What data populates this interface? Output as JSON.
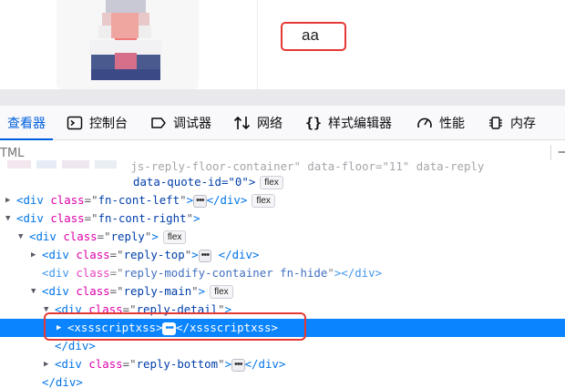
{
  "page": {
    "comment_text": "aa"
  },
  "toolbar": {
    "tabs": [
      {
        "label": "查看器",
        "icon": "inspector-icon",
        "active": true
      },
      {
        "label": "控制台",
        "icon": "console-icon",
        "active": false
      },
      {
        "label": "调试器",
        "icon": "debugger-icon",
        "active": false
      },
      {
        "label": "网络",
        "icon": "network-icon",
        "active": false
      },
      {
        "label": "样式编辑器",
        "icon": "style-editor-icon",
        "active": false
      },
      {
        "label": "性能",
        "icon": "performance-icon",
        "active": false
      },
      {
        "label": "内存",
        "icon": "memory-icon",
        "active": false
      }
    ]
  },
  "filter": {
    "label": "TML"
  },
  "tree": {
    "row0": {
      "text": " js-reply-floor-container\" data-floor=\"11\" data-reply"
    },
    "row1": {
      "text": "data-quote-id=\"0\">",
      "badge": "flex"
    },
    "row2": {
      "tag": "div",
      "attr": "class",
      "value": "fn-cont-left"
    },
    "row3": {
      "tag": "div",
      "attr": "class",
      "value": "fn-cont-right"
    },
    "row4": {
      "tag": "div",
      "attr": "class",
      "value": "reply",
      "badge": "flex"
    },
    "row5": {
      "tag": "div",
      "attr": "class",
      "value": "reply-top"
    },
    "row6": {
      "tag": "div",
      "attr": "class",
      "value": "reply-modify-container fn-hide"
    },
    "row7": {
      "tag": "div",
      "attr": "class",
      "value": "reply-main",
      "badge": "flex"
    },
    "row8": {
      "tag": "div",
      "attr": "class",
      "value": "reply-detail"
    },
    "row9": {
      "tag": "xssscriptxss"
    },
    "row10": {
      "tag": "div"
    },
    "row11": {
      "tag": "div",
      "attr": "class",
      "value": "reply-bottom"
    },
    "row12": {
      "tag": "div"
    }
  },
  "colors": {
    "highlight": "#e53935",
    "selection": "#0a84ff",
    "tag": "#0074e8",
    "attr_name": "#dd00a9",
    "attr_value": "#003eaa"
  }
}
